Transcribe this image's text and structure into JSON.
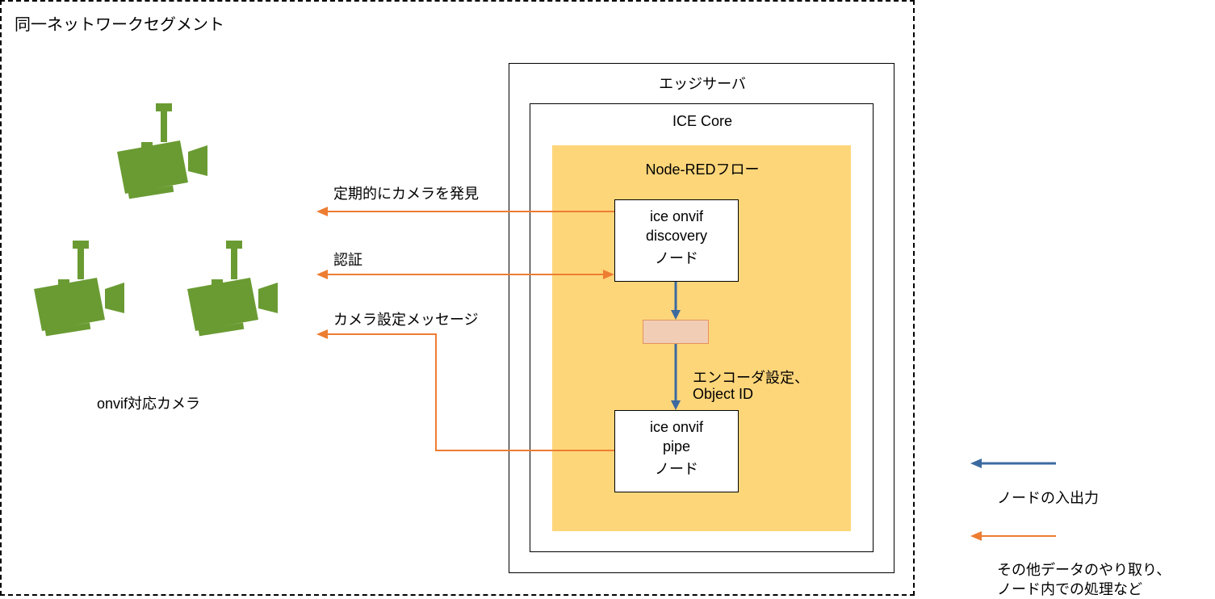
{
  "diagram": {
    "segment_title": "同一ネットワークセグメント",
    "camera_label": "onvif対応カメラ",
    "edge_server": "エッジサーバ",
    "ice_core": "ICE Core",
    "node_red_flow": "Node-REDフロー",
    "discovery_node_l1": "ice onvif",
    "discovery_node_l2": "discovery",
    "discovery_node_l3": "ノード",
    "pipe_node_l1": "ice onvif",
    "pipe_node_l2": "pipe",
    "pipe_node_l3": "ノード",
    "arrow_discover": "定期的にカメラを発見",
    "arrow_auth": "認証",
    "arrow_camera_setting": "カメラ設定メッセージ",
    "arrow_encoder_l1": "エンコーダ設定、",
    "arrow_encoder_l2": "Object ID",
    "legend_blue": "ノードの入出力",
    "legend_orange_l1": "その他データのやり取り、",
    "legend_orange_l2": "ノード内での処理など"
  }
}
